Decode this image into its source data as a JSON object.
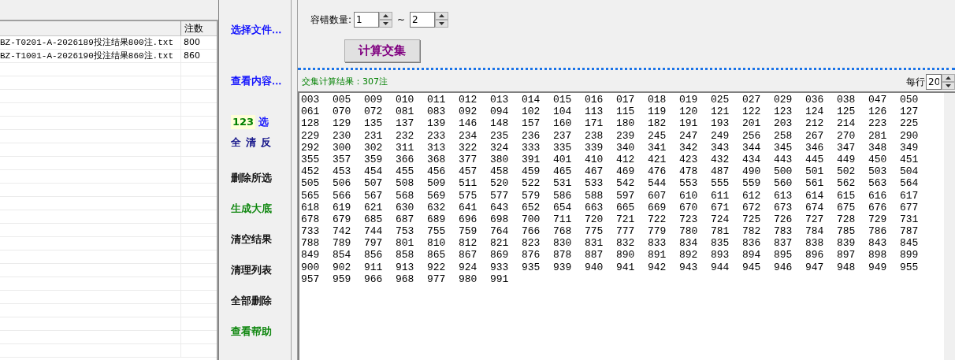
{
  "file_table": {
    "count_column": "注数",
    "rows": [
      {
        "file": "BZ-T0201-A-2026189投注结果800注.txt",
        "count": "800"
      },
      {
        "file": "BZ-T1001-A-2026190投注结果860注.txt",
        "count": "860"
      }
    ]
  },
  "actions": [
    {
      "kind": "link",
      "label": "选择文件...",
      "color": "#0000ff"
    },
    {
      "kind": "link",
      "label": "查看内容...",
      "color": "#0000ff"
    },
    {
      "kind": "badge",
      "badge": "123",
      "label": "选",
      "color": "#0000ff"
    },
    {
      "kind": "group",
      "labels": [
        "全",
        "清",
        "反"
      ],
      "color": "#000080"
    },
    {
      "kind": "link",
      "label": "删除所选",
      "color": "#000000"
    },
    {
      "kind": "link",
      "label": "生成大底",
      "color": "#008000"
    },
    {
      "kind": "link",
      "label": "清空结果",
      "color": "#000000"
    },
    {
      "kind": "link",
      "label": "清理列表",
      "color": "#000000"
    },
    {
      "kind": "link",
      "label": "全部删除",
      "color": "#000000"
    },
    {
      "kind": "link",
      "label": "查看帮助",
      "color": "#008000"
    }
  ],
  "tolerance": {
    "label": "容错数量:",
    "from": "1",
    "separator": "~",
    "to": "2"
  },
  "compute_button": "计算交集",
  "result": {
    "label": "交集计算结果：307注",
    "per_row_label": "每行",
    "per_row": "20",
    "rows": [
      [
        "003",
        "005",
        "009",
        "010",
        "011",
        "012",
        "013",
        "014",
        "015",
        "016",
        "017",
        "018",
        "019",
        "025",
        "027",
        "029",
        "036",
        "038",
        "047",
        "050"
      ],
      [
        "061",
        "070",
        "072",
        "081",
        "083",
        "092",
        "094",
        "102",
        "104",
        "113",
        "115",
        "119",
        "120",
        "121",
        "122",
        "123",
        "124",
        "125",
        "126",
        "127"
      ],
      [
        "128",
        "129",
        "135",
        "137",
        "139",
        "146",
        "148",
        "157",
        "160",
        "171",
        "180",
        "182",
        "191",
        "193",
        "201",
        "203",
        "212",
        "214",
        "223",
        "225"
      ],
      [
        "229",
        "230",
        "231",
        "232",
        "233",
        "234",
        "235",
        "236",
        "237",
        "238",
        "239",
        "245",
        "247",
        "249",
        "256",
        "258",
        "267",
        "270",
        "281",
        "290"
      ],
      [
        "292",
        "300",
        "302",
        "311",
        "313",
        "322",
        "324",
        "333",
        "335",
        "339",
        "340",
        "341",
        "342",
        "343",
        "344",
        "345",
        "346",
        "347",
        "348",
        "349"
      ],
      [
        "355",
        "357",
        "359",
        "366",
        "368",
        "377",
        "380",
        "391",
        "401",
        "410",
        "412",
        "421",
        "423",
        "432",
        "434",
        "443",
        "445",
        "449",
        "450",
        "451"
      ],
      [
        "452",
        "453",
        "454",
        "455",
        "456",
        "457",
        "458",
        "459",
        "465",
        "467",
        "469",
        "476",
        "478",
        "487",
        "490",
        "500",
        "501",
        "502",
        "503",
        "504"
      ],
      [
        "505",
        "506",
        "507",
        "508",
        "509",
        "511",
        "520",
        "522",
        "531",
        "533",
        "542",
        "544",
        "553",
        "555",
        "559",
        "560",
        "561",
        "562",
        "563",
        "564"
      ],
      [
        "565",
        "566",
        "567",
        "568",
        "569",
        "575",
        "577",
        "579",
        "586",
        "588",
        "597",
        "607",
        "610",
        "611",
        "612",
        "613",
        "614",
        "615",
        "616",
        "617"
      ],
      [
        "618",
        "619",
        "621",
        "630",
        "632",
        "641",
        "643",
        "652",
        "654",
        "663",
        "665",
        "669",
        "670",
        "671",
        "672",
        "673",
        "674",
        "675",
        "676",
        "677"
      ],
      [
        "678",
        "679",
        "685",
        "687",
        "689",
        "696",
        "698",
        "700",
        "711",
        "720",
        "721",
        "722",
        "723",
        "724",
        "725",
        "726",
        "727",
        "728",
        "729",
        "731"
      ],
      [
        "733",
        "742",
        "744",
        "753",
        "755",
        "759",
        "764",
        "766",
        "768",
        "775",
        "777",
        "779",
        "780",
        "781",
        "782",
        "783",
        "784",
        "785",
        "786",
        "787"
      ],
      [
        "788",
        "789",
        "797",
        "801",
        "810",
        "812",
        "821",
        "823",
        "830",
        "831",
        "832",
        "833",
        "834",
        "835",
        "836",
        "837",
        "838",
        "839",
        "843",
        "845"
      ],
      [
        "849",
        "854",
        "856",
        "858",
        "865",
        "867",
        "869",
        "876",
        "878",
        "887",
        "890",
        "891",
        "892",
        "893",
        "894",
        "895",
        "896",
        "897",
        "898",
        "899"
      ],
      [
        "900",
        "902",
        "911",
        "913",
        "922",
        "924",
        "933",
        "935",
        "939",
        "940",
        "941",
        "942",
        "943",
        "944",
        "945",
        "946",
        "947",
        "948",
        "949",
        "955"
      ],
      [
        "957",
        "959",
        "966",
        "968",
        "977",
        "980",
        "991"
      ]
    ]
  }
}
